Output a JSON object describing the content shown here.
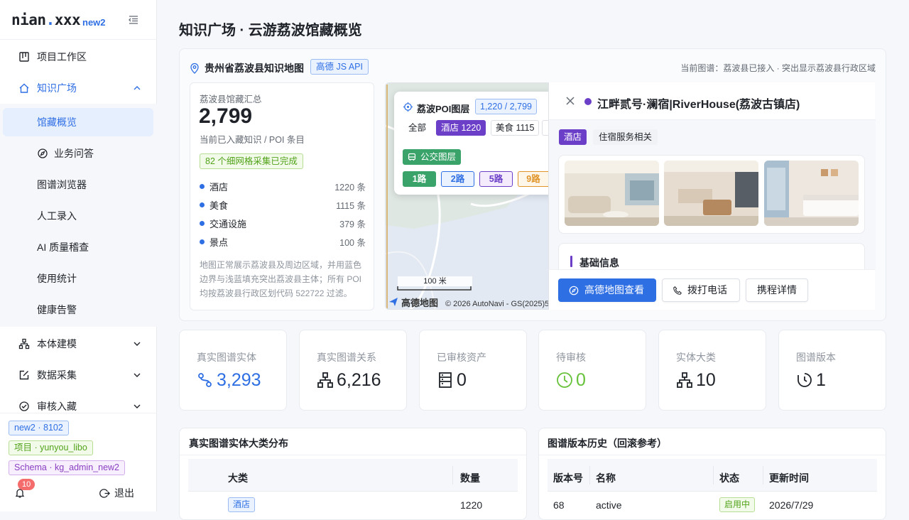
{
  "app": {
    "logo_a": "nian",
    "logo_dot": ".",
    "logo_b": "xxx",
    "env_tag": "new2"
  },
  "nav": {
    "workspace": "项目工作区",
    "knowledge": "知识广场",
    "sub": [
      "馆藏概览",
      "业务问答",
      "图谱浏览器",
      "人工录入",
      "AI 质量稽查",
      "使用统计",
      "健康告警"
    ],
    "ontology": "本体建模",
    "collect": "数据采集",
    "review": "审核入藏"
  },
  "footer": {
    "tags": [
      "new2 · 8102",
      "项目 · yunyou_libo",
      "Schema · kg_admin_new2"
    ],
    "notif_count": "10",
    "logout": "退出"
  },
  "page_title": "知识广场 · 云游荔波馆藏概览",
  "map_panel": {
    "title": "贵州省荔波县知识地图",
    "api_tag": "高德 JS API",
    "note": "当前图谱：荔波县已接入 · 突出显示荔波县行政区域"
  },
  "summary": {
    "title": "荔波县馆藏汇总",
    "total": "2,799",
    "sub": "当前已入藏知识 / POI 条目",
    "done_tag": "82 个细网格采集已完成",
    "cats": [
      {
        "name": "酒店",
        "count": "1220 条"
      },
      {
        "name": "美食",
        "count": "1115 条"
      },
      {
        "name": "交通设施",
        "count": "379 条"
      },
      {
        "name": "景点",
        "count": "100 条"
      }
    ],
    "desc": "地图正常展示荔波县及周边区域，并用蓝色边界与浅蓝填充突出荔波县主体；所有 POI 均按荔波县行政区划代码 522722 过滤。"
  },
  "poi_layer": {
    "title": "荔波POI图层",
    "count": "1,220 / 2,799",
    "filters": [
      "全部",
      "酒店 1220",
      "美食 1115"
    ],
    "bus_label": "公交图层",
    "routes": [
      "1路",
      "2路",
      "5路",
      "9路"
    ]
  },
  "map_footer": {
    "scale": "100 米",
    "brand": "高德地图",
    "copyright": "© 2026 AutoNavi - GS(2025)5996号"
  },
  "detail": {
    "name": "江畔贰号·澜宿|RiverHouse(荔波古镇店)",
    "type_tag": "酒店",
    "sub_tag": "住宿服务相关",
    "section": "基础信息",
    "btn_map": "高德地图查看",
    "btn_call": "拨打电话",
    "btn_trip": "携程详情"
  },
  "stats": [
    {
      "label": "真实图谱实体",
      "value": "3,293",
      "icon": "entity-link-icon",
      "color": "#2f6fe4"
    },
    {
      "label": "真实图谱关系",
      "value": "6,216",
      "icon": "hierarchy-icon",
      "color": "#1f2329"
    },
    {
      "label": "已审核资产",
      "value": "0",
      "icon": "server-icon",
      "color": "#1f2329"
    },
    {
      "label": "待审核",
      "value": "0",
      "icon": "clock-icon",
      "color": "#67c23a"
    },
    {
      "label": "实体大类",
      "value": "10",
      "icon": "hierarchy-icon",
      "color": "#1f2329"
    },
    {
      "label": "图谱版本",
      "value": "1",
      "icon": "history-icon",
      "color": "#1f2329"
    }
  ],
  "dist_table": {
    "title": "真实图谱实体大类分布",
    "cols": [
      "大类",
      "数量"
    ],
    "row": {
      "cat": "酒店",
      "count": "1220"
    }
  },
  "version_table": {
    "title": "图谱版本历史（回滚参考）",
    "cols": [
      "版本号",
      "名称",
      "状态",
      "更新时间"
    ],
    "row": {
      "ver": "68",
      "name": "active",
      "status": "启用中",
      "time": "2026/7/29"
    }
  }
}
